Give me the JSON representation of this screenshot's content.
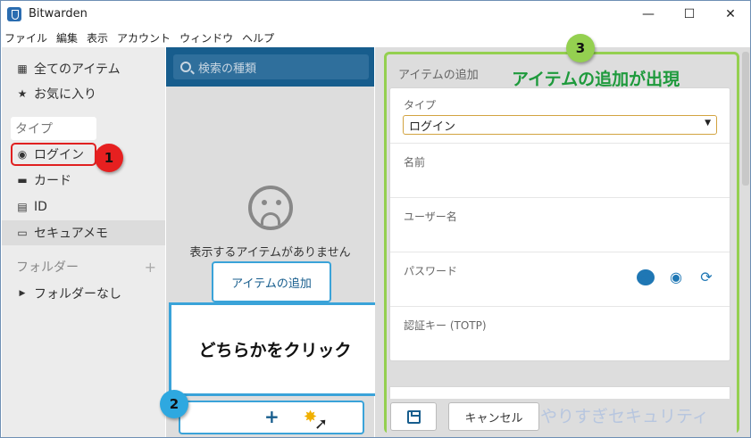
{
  "window": {
    "title": "Bitwarden",
    "controls": {
      "minimize": "—",
      "maximize": "☐",
      "close": "✕"
    }
  },
  "menu": [
    "ファイル",
    "編集",
    "表示",
    "アカウント",
    "ウィンドウ",
    "ヘルプ"
  ],
  "sidebar": {
    "all_items": "全てのアイテム",
    "favorites": "お気に入り",
    "type_header": "タイプ",
    "types": [
      "ログイン",
      "カード",
      "ID",
      "セキュアメモ"
    ],
    "folder_header": "フォルダー",
    "folder_add": "+",
    "folders": [
      "フォルダーなし"
    ]
  },
  "middle": {
    "search_placeholder": "検索の種類",
    "empty_message": "表示するアイテムがありません",
    "add_item_label": "アイテムの追加",
    "add_plus": "+"
  },
  "callout": {
    "text": "どちらかをクリック"
  },
  "detail": {
    "heading": "アイテムの追加",
    "annotation_title": "アイテムの追加が出現",
    "type_label": "タイプ",
    "type_value": "ログイン",
    "name_label": "名前",
    "username_label": "ユーザー名",
    "password_label": "パスワード",
    "totp_label": "認証キー (TOTP)",
    "cancel_label": "キャンセル"
  },
  "badges": [
    "1",
    "2",
    "3"
  ],
  "watermark": "やりすぎセキュリティ",
  "colors": {
    "accent": "#175d8d",
    "highlight_blue": "#3aa3d9",
    "badge_red": "#e62020",
    "badge_blue": "#2ea8e0",
    "badge_green": "#94d050",
    "annotation_green": "#1e9a3c"
  }
}
